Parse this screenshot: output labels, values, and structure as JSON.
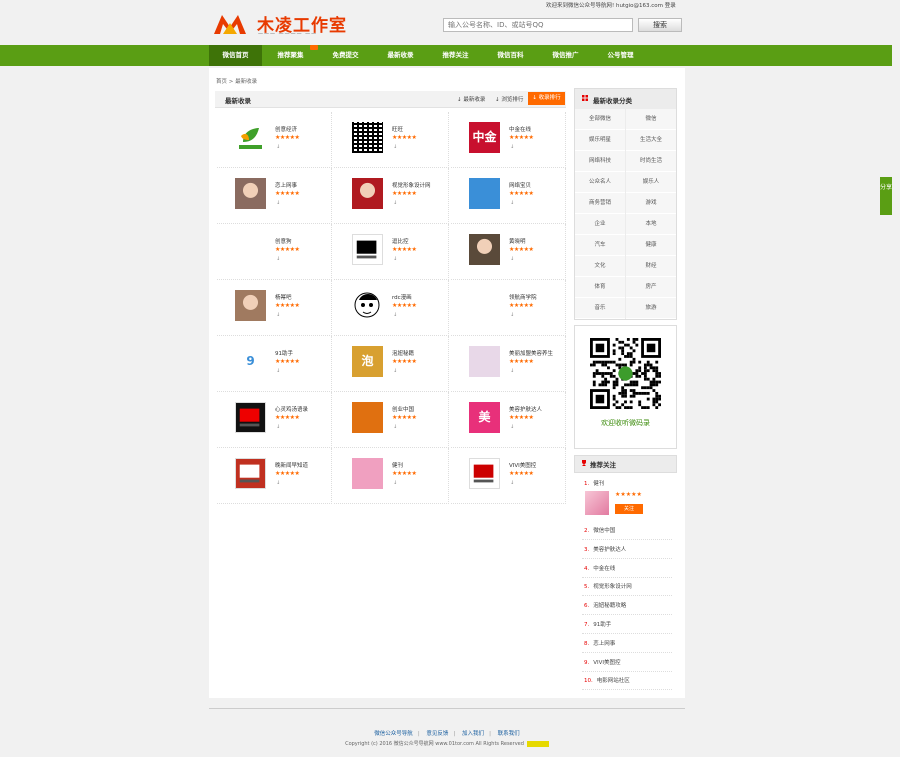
{
  "header": {
    "logo_text": "木凌工作室",
    "logo_sub": "——— ———— ——",
    "top_notice": "欢迎来到微信公众号导航网! hutgio@163.com 登录",
    "search": {
      "placeholder": "输入公号名称、ID、或站号QQ",
      "button": "搜索"
    }
  },
  "nav": {
    "items": [
      "微信首页",
      "推荐聚集",
      "免费提交",
      "最新收录",
      "推荐关注",
      "微信百科",
      "微信推广",
      "公号管理"
    ],
    "active": 0
  },
  "breadcrumb": {
    "home": "首页",
    "sep": ">",
    "current": "最新收录"
  },
  "list": {
    "title": "最新收录",
    "sort_tabs": [
      "最新收录",
      "浏览排行",
      "收录排行"
    ],
    "apps": [
      {
        "name": "创意经济",
        "stars": "★★★★★",
        "dl": "↓",
        "icon": "leaf-logo"
      },
      {
        "name": "旺旺",
        "stars": "★★★★★",
        "dl": "↓",
        "icon": "qr-code"
      },
      {
        "name": "中金在线",
        "stars": "★★★★★",
        "dl": "↓",
        "icon": "zhongjin-logo"
      },
      {
        "name": "恋上网事",
        "stars": "★★★★★",
        "dl": "↓",
        "icon": "photo-woman"
      },
      {
        "name": "视觉形象设计网",
        "stars": "★★★★★",
        "dl": "↓",
        "icon": "red-lips"
      },
      {
        "name": "网络宝贝",
        "stars": "★★★★★",
        "dl": "↓",
        "icon": "blue-cartoon"
      },
      {
        "name": "创意狗",
        "stars": "★★★★★",
        "dl": "↓",
        "icon": "dog-drawing"
      },
      {
        "name": "逗比控",
        "stars": "★★★★★",
        "dl": "↓",
        "icon": "bw-logo"
      },
      {
        "name": "黄晓明",
        "stars": "★★★★★",
        "dl": "↓",
        "icon": "photo-man"
      },
      {
        "name": "杨幂吧",
        "stars": "★★★★★",
        "dl": "↓",
        "icon": "photo-woman2"
      },
      {
        "name": "rdc漫画",
        "stars": "★★★★★",
        "dl": "↓",
        "icon": "cartoon-face"
      },
      {
        "name": "领航商学院",
        "stars": "★★★★★",
        "dl": "↓",
        "icon": "text-logo"
      },
      {
        "name": "91助手",
        "stars": "★★★★★",
        "dl": "↓",
        "icon": "91-logo"
      },
      {
        "name": "泡妞秘籍",
        "stars": "★★★★★",
        "dl": "↓",
        "icon": "paoniu-logo"
      },
      {
        "name": "美丽加盟美容养生",
        "stars": "★★★★★",
        "dl": "↓",
        "icon": "m-logo"
      },
      {
        "name": "心灵鸡汤语录",
        "stars": "★★★★★",
        "dl": "↓",
        "icon": "heart-logo"
      },
      {
        "name": "创业中国",
        "stars": "★★★★★",
        "dl": "↓",
        "icon": "orange-logo"
      },
      {
        "name": "美容护肤达人",
        "stars": "★★★★★",
        "dl": "↓",
        "icon": "mei-logo"
      },
      {
        "name": "晚新闻早知道",
        "stars": "★★★★★",
        "dl": "↓",
        "icon": "news-logo"
      },
      {
        "name": "健刊",
        "stars": "★★★★★",
        "dl": "↓",
        "icon": "pink-flower"
      },
      {
        "name": "VIVI美图控",
        "stars": "★★★★★",
        "dl": "↓",
        "icon": "vivi-logo"
      }
    ]
  },
  "categories": {
    "title": "最新收录分类",
    "items": [
      "全部微信",
      "微信",
      "娱乐明星",
      "生活大全",
      "网络科技",
      "时尚生活",
      "公众名人",
      "娱乐人",
      "商务营销",
      "游戏",
      "企业",
      "本地",
      "汽车",
      "健康",
      "文化",
      "财经",
      "体育",
      "房产",
      "音乐",
      "旅游"
    ]
  },
  "qr": {
    "caption": "欢迎收听微码录"
  },
  "recommend": {
    "title": "推荐关注",
    "first": {
      "rank": "1.",
      "name": "健刊",
      "stars": "★★★★★",
      "follow": "关注"
    },
    "items": [
      {
        "rank": "2.",
        "name": "微信中国"
      },
      {
        "rank": "3.",
        "name": "美容护肤达人"
      },
      {
        "rank": "4.",
        "name": "中金在线"
      },
      {
        "rank": "5.",
        "name": "视觉形象设计网"
      },
      {
        "rank": "6.",
        "name": "泡妞秘籍攻略"
      },
      {
        "rank": "7.",
        "name": "91助手"
      },
      {
        "rank": "8.",
        "name": "恋上网事"
      },
      {
        "rank": "9.",
        "name": "VIVI美图控"
      },
      {
        "rank": "10.",
        "name": "电影网站社区"
      }
    ]
  },
  "side_share": "分享",
  "footer": {
    "links": [
      "微信公众号导航",
      "意见反馈",
      "加入我们",
      "联系我们"
    ],
    "copyright": "Copyright (c) 2016 微信公众号导航网 www.01tor.com All Rights Reserved"
  },
  "colors": {
    "brand": "#5a9e14",
    "accent": "#ff6a00",
    "logo": "#e83a00"
  }
}
